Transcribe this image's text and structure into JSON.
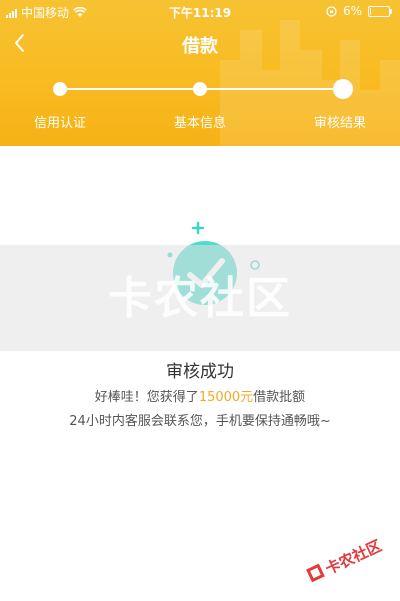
{
  "status_bar": {
    "carrier": "中国移动",
    "time": "下午11:19",
    "battery": "6%",
    "battery_level": 0.06
  },
  "nav": {
    "title": "借款"
  },
  "steps": [
    {
      "label": "信用认证"
    },
    {
      "label": "基本信息"
    },
    {
      "label": "审核结果"
    }
  ],
  "result": {
    "title": "审核成功",
    "line1_prefix": "好棒哇！您获得了",
    "amount": "15000元",
    "line1_suffix": "借款批额",
    "line2": "24小时内客服会联系您，手机要保持通畅哦~"
  },
  "watermark": {
    "text": "卡农社区"
  },
  "colors": {
    "header": "#f8bb21",
    "accent": "#f5a623",
    "teal": "#3fd6c8"
  }
}
